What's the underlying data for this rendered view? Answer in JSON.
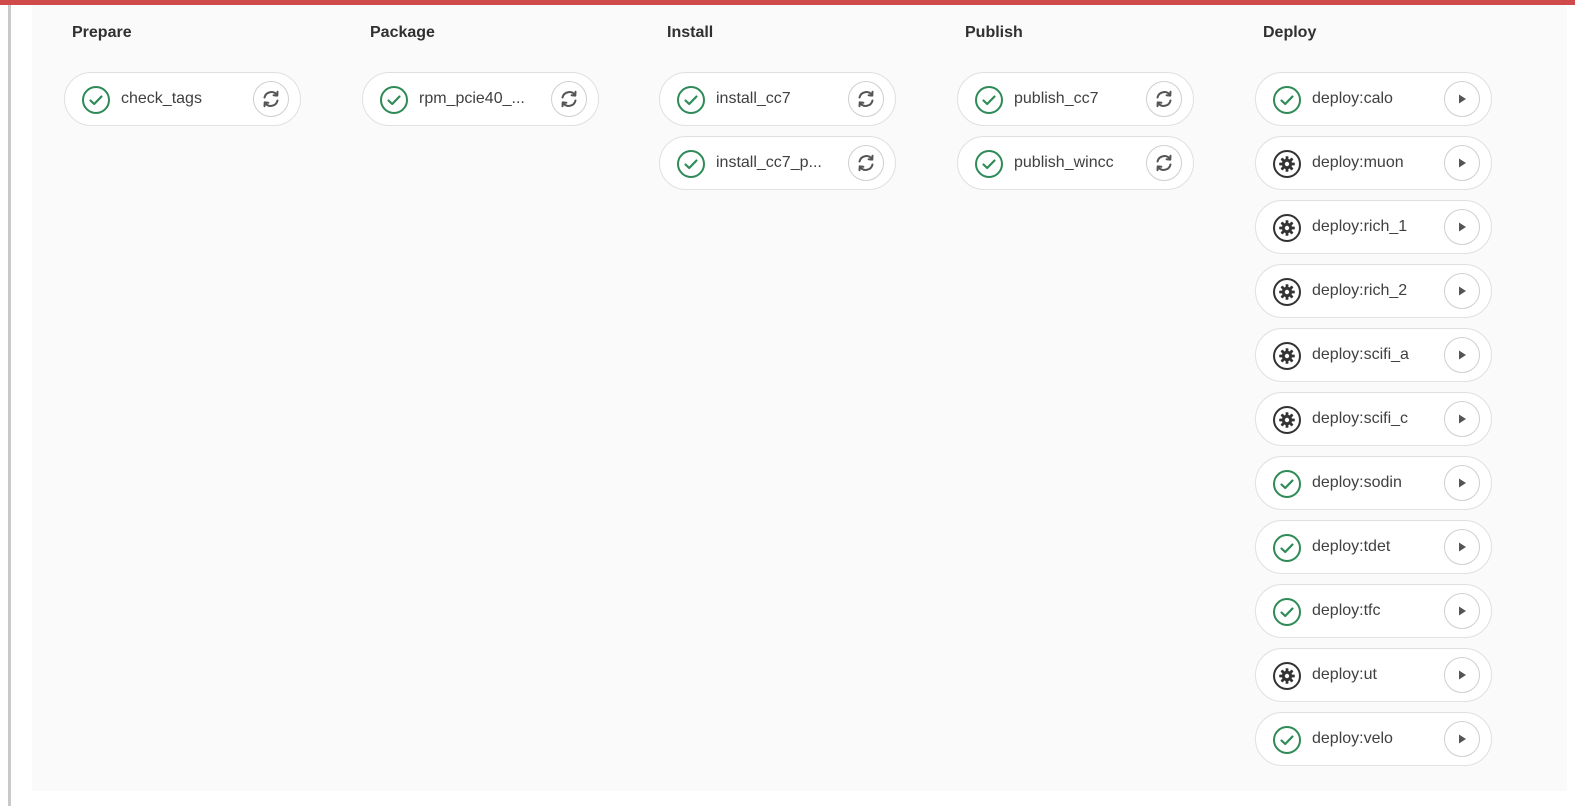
{
  "colors": {
    "accent_bar": "#cf4b4b",
    "success": "#2e8b57",
    "manual": "#333333",
    "text": "#404040"
  },
  "stages": [
    {
      "title": "Prepare",
      "jobs": [
        {
          "name": "check_tags",
          "status": "success",
          "action": "retry"
        }
      ]
    },
    {
      "title": "Package",
      "jobs": [
        {
          "name": "rpm_pcie40_...",
          "status": "success",
          "action": "retry"
        }
      ]
    },
    {
      "title": "Install",
      "jobs": [
        {
          "name": "install_cc7",
          "status": "success",
          "action": "retry"
        },
        {
          "name": "install_cc7_p...",
          "status": "success",
          "action": "retry"
        }
      ]
    },
    {
      "title": "Publish",
      "jobs": [
        {
          "name": "publish_cc7",
          "status": "success",
          "action": "retry"
        },
        {
          "name": "publish_wincc",
          "status": "success",
          "action": "retry"
        }
      ]
    },
    {
      "title": "Deploy",
      "jobs": [
        {
          "name": "deploy:calo",
          "status": "success",
          "action": "play"
        },
        {
          "name": "deploy:muon",
          "status": "manual",
          "action": "play"
        },
        {
          "name": "deploy:rich_1",
          "status": "manual",
          "action": "play"
        },
        {
          "name": "deploy:rich_2",
          "status": "manual",
          "action": "play"
        },
        {
          "name": "deploy:scifi_a",
          "status": "manual",
          "action": "play"
        },
        {
          "name": "deploy:scifi_c",
          "status": "manual",
          "action": "play"
        },
        {
          "name": "deploy:sodin",
          "status": "success",
          "action": "play"
        },
        {
          "name": "deploy:tdet",
          "status": "success",
          "action": "play"
        },
        {
          "name": "deploy:tfc",
          "status": "success",
          "action": "play"
        },
        {
          "name": "deploy:ut",
          "status": "manual",
          "action": "play"
        },
        {
          "name": "deploy:velo",
          "status": "success",
          "action": "play"
        }
      ]
    }
  ]
}
